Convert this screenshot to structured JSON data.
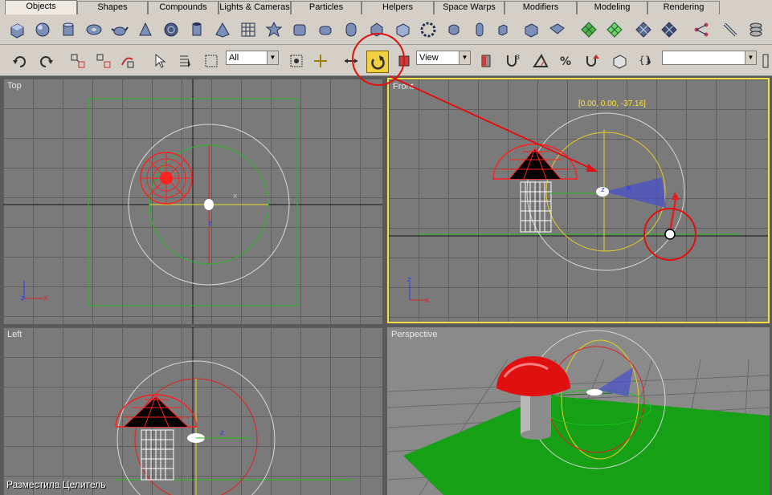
{
  "tabs": [
    {
      "label": "Objects",
      "active": true
    },
    {
      "label": "Shapes"
    },
    {
      "label": "Compounds"
    },
    {
      "label": "Lights & Cameras"
    },
    {
      "label": "Particles"
    },
    {
      "label": "Helpers"
    },
    {
      "label": "Space Warps"
    },
    {
      "label": "Modifiers"
    },
    {
      "label": "Modeling"
    },
    {
      "label": "Rendering"
    }
  ],
  "toolbar": {
    "selection_filter": "All",
    "reference_coord": "View",
    "named_selection": ""
  },
  "viewports": {
    "top": "Top",
    "front": "Front",
    "left": "Left",
    "perspective": "Perspective"
  },
  "front_coord_readout": "[0.00, 0.00, -37.16]",
  "caption": "Разместила Целитель",
  "icons": [
    "box",
    "sphere",
    "cylinder",
    "torus",
    "teapot",
    "cone",
    "geosphere",
    "tube",
    "pyramid",
    "plane",
    "hedra",
    "chamferbox",
    "oiltank",
    "capsule",
    "gengon",
    "ringwave",
    "hose",
    "spindle",
    "l-ext",
    "c-ext",
    "prism",
    "patch-grid",
    "nurbs",
    "mesh",
    "compound",
    "particle",
    "spline",
    "undo",
    "redo",
    "link",
    "unlink",
    "bind-space-warp",
    "select",
    "select-by-name",
    "select-region",
    "select-move",
    "rotate",
    "scale",
    "mirror",
    "align",
    "snap",
    "angle-snap",
    "percent-snap",
    "spinner-snap",
    "edit-named",
    "named-selection"
  ]
}
